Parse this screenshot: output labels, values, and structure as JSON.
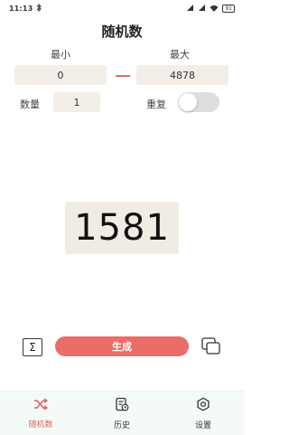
{
  "status_bar": {
    "time": "11:13",
    "battery": "91"
  },
  "header": {
    "title": "随机数"
  },
  "range": {
    "min_label": "最小",
    "min_value": "0",
    "max_label": "最大",
    "max_value": "4878"
  },
  "count": {
    "label": "数量",
    "value": "1"
  },
  "repeat": {
    "label": "重复",
    "enabled": false
  },
  "result": {
    "value": "1581"
  },
  "actions": {
    "sum_symbol": "Σ",
    "generate_label": "生成"
  },
  "tabs": [
    {
      "label": "随机数",
      "icon": "shuffle-icon",
      "active": true
    },
    {
      "label": "历史",
      "icon": "history-icon",
      "active": false
    },
    {
      "label": "设置",
      "icon": "gear-icon",
      "active": false
    }
  ],
  "colors": {
    "accent": "#ea6d6a",
    "tab_active": "#e2625f",
    "field_bg": "#f3eee7",
    "result_bg": "#f0ece4"
  }
}
